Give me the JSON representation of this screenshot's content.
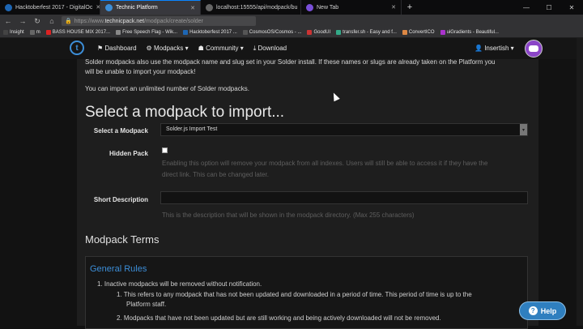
{
  "browser": {
    "tabs": [
      {
        "label": "Hacktoberfest 2017 - DigitalOc",
        "color": "#1d66b4"
      },
      {
        "label": "Technic Platform",
        "color": "#3c8ed8",
        "active": true
      },
      {
        "label": "localhost:15555/api/modpack/bu",
        "color": "#666666"
      },
      {
        "label": "New Tab",
        "color": "#7a4fd9"
      }
    ],
    "url_prefix": "https://www.",
    "url_domain": "technicpack.net",
    "url_path": "/modpack/create/solder",
    "bookmarks": [
      {
        "label": "Insight",
        "color": "#444"
      },
      {
        "label": "m",
        "color": "#666"
      },
      {
        "label": "BASS HOUSE MIX 2017...",
        "color": "#d22"
      },
      {
        "label": "Free Speech Flag - Wik...",
        "color": "#888"
      },
      {
        "label": "Hacktoberfest 2017 ...",
        "color": "#1d66b4"
      },
      {
        "label": "CosmosOS/Cosmos - ...",
        "color": "#555"
      },
      {
        "label": "GoodUI",
        "color": "#c33"
      },
      {
        "label": "transfer.sh - Easy and f...",
        "color": "#3a8"
      },
      {
        "label": "ConvertICO",
        "color": "#d84"
      },
      {
        "label": "uiGradients - Beautiful...",
        "color": "#a3c"
      }
    ]
  },
  "header": {
    "nav": [
      "Dashboard",
      "Modpacks ▾",
      "Community ▾",
      "Download"
    ],
    "user": "Insertish ▾"
  },
  "content": {
    "intro_text_1": "Solder modpacks also use the modpack name and slug set in your Solder install. If these names or slugs are already taken on the Platform you",
    "intro_text_2": "will be unable to import your modpack!",
    "intro_text_3": "You can import an unlimited number of Solder modpacks.",
    "heading": "Select a modpack to import...",
    "select_label": "Select a Modpack",
    "select_value": "Solder.js Import Test",
    "hidden_label": "Hidden Pack",
    "hidden_help_1": "Enabling this option will remove your modpack from all indexes. Users will still be able to access it if they have the",
    "hidden_help_2": "direct link. This can be changed later.",
    "desc_label": "Short Description",
    "desc_help": "This is the description that will be shown in the modpack directory. (Max 255 characters)",
    "terms_heading": "Modpack Terms",
    "terms_title": "General Rules",
    "terms_lines": [
      "1. Inactive modpacks will be removed without notification.",
      "1. This refers to any modpack that has not been updated and downloaded in a period of time. This period of time is up to the",
      "Platform staff.",
      "2. Modpacks that have not been updated but are still working and being actively downloaded will not be removed."
    ]
  },
  "help_button": "Help"
}
